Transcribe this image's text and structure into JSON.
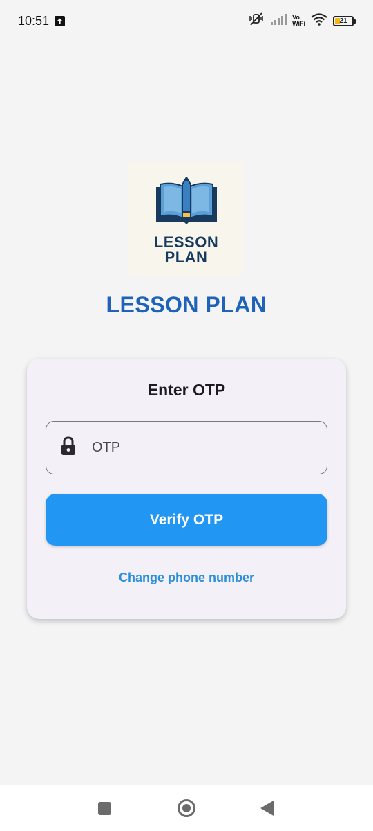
{
  "status_bar": {
    "time": "10:51",
    "network_label_top": "Vo",
    "network_label_bottom": "WiFi",
    "battery_level": "21",
    "icons": [
      "upload-icon",
      "mute-icon",
      "signal-icon",
      "wifi-icon",
      "battery-icon"
    ]
  },
  "logo": {
    "line1": "LESSON",
    "line2": "PLAN",
    "icon": "book-pencil-icon"
  },
  "app": {
    "title": "LESSON PLAN"
  },
  "card": {
    "title": "Enter OTP",
    "otp_field": {
      "placeholder": "OTP",
      "value": "",
      "icon": "lock-icon"
    },
    "verify_button_label": "Verify OTP",
    "change_phone_link": "Change phone number"
  },
  "nav_bar": {
    "items": [
      "recents-button",
      "home-button",
      "back-button"
    ]
  },
  "colors": {
    "background": "#f4f4f5",
    "title_blue": "#1e63b8",
    "button_blue": "#2196f3",
    "link_blue": "#2a8fd8",
    "card_bg": "#f4f0f7",
    "logo_bg": "#f8f5ec",
    "logo_navy": "#173a5e",
    "battery_yellow": "#f2b618"
  }
}
